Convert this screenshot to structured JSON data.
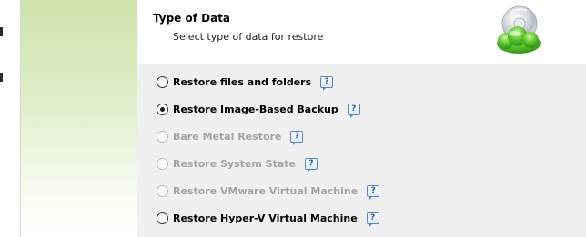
{
  "header": {
    "title": "Type of Data",
    "subtitle": "Select type of data for restore",
    "logo_icon": "cloud-disc-logo-icon"
  },
  "options": [
    {
      "label": "Restore files and folders",
      "selected": false,
      "enabled": true
    },
    {
      "label": "Restore Image-Based Backup",
      "selected": true,
      "enabled": true
    },
    {
      "label": "Bare Metal Restore",
      "selected": false,
      "enabled": false
    },
    {
      "label": "Restore System State",
      "selected": false,
      "enabled": false
    },
    {
      "label": "Restore VMware Virtual Machine",
      "selected": false,
      "enabled": false
    },
    {
      "label": "Restore Hyper-V Virtual Machine",
      "selected": false,
      "enabled": true
    }
  ],
  "help_icon": {
    "glyph": "?",
    "name": "help-icon"
  },
  "colors": {
    "accent_green": "#5cc62e",
    "disabled_text": "#a3a3a3",
    "help_blue": "#1f56b5"
  }
}
